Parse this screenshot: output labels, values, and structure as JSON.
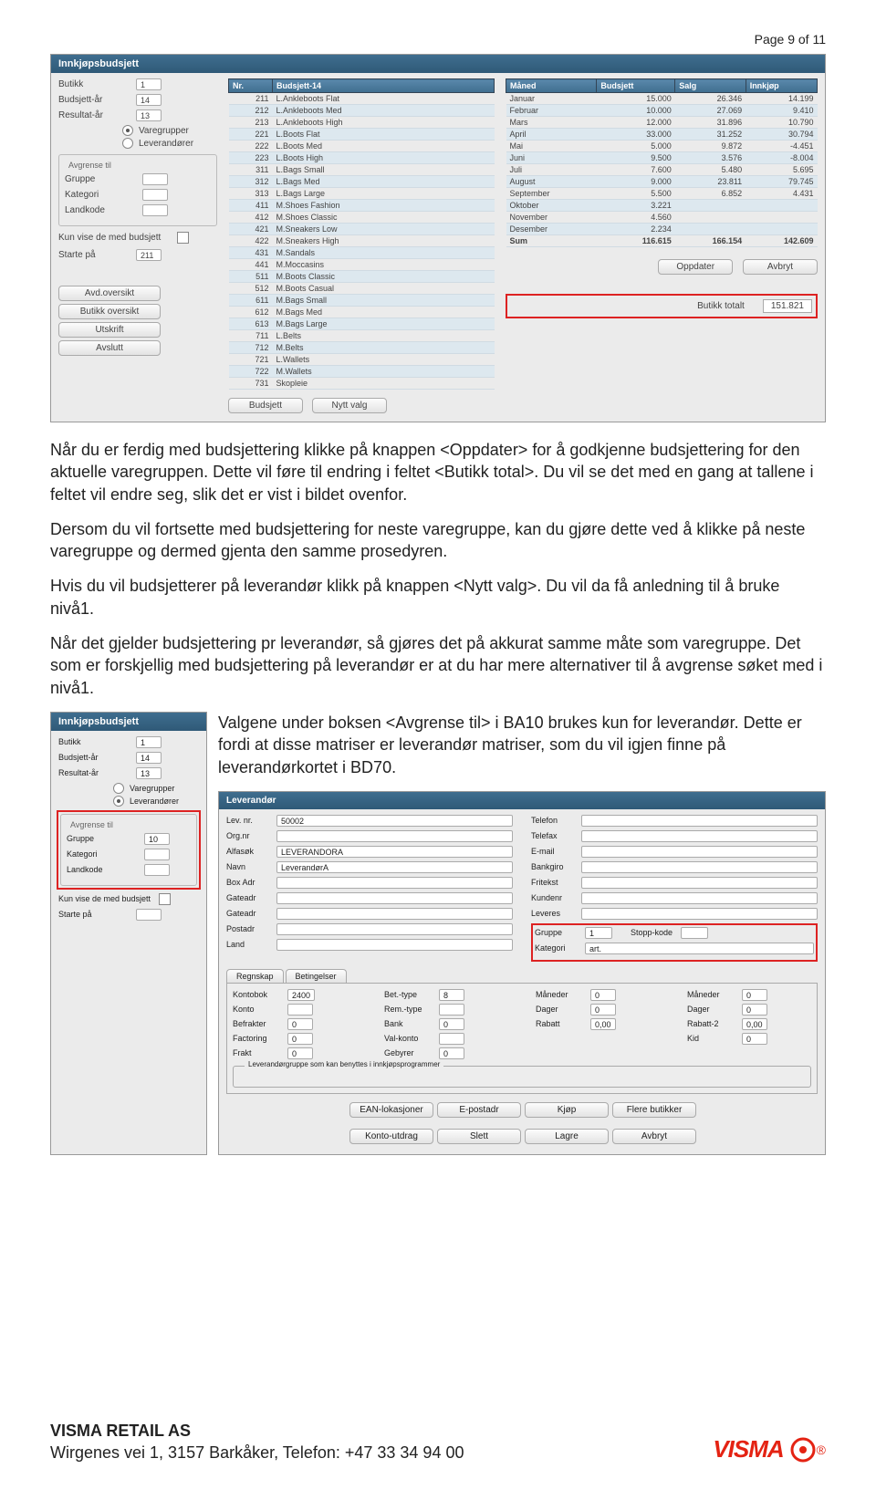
{
  "page_num": "Page 9 of 11",
  "shotA": {
    "title": "Innkjøpsbudsjett",
    "left": {
      "butikk_lbl": "Butikk",
      "butikk_val": "1",
      "budar_lbl": "Budsjett-år",
      "budar_val": "14",
      "resar_lbl": "Resultat-år",
      "resar_val": "13",
      "radio1": "Varegrupper",
      "radio2": "Leverandører",
      "avgrense_title": "Avgrense til",
      "gruppe_lbl": "Gruppe",
      "kategori_lbl": "Kategori",
      "landkode_lbl": "Landkode",
      "kunvise_lbl": "Kun vise de med budsjett",
      "start_lbl": "Starte på",
      "start_val": "211",
      "btn_avd": "Avd.oversikt",
      "btn_butikk": "Butikk oversikt",
      "btn_utskrift": "Utskrift",
      "btn_avslutt": "Avslutt"
    },
    "mid": {
      "h_nr": "Nr.",
      "h_bud": "Budsjett-14",
      "rows": [
        [
          "211",
          "L.Ankleboots Flat"
        ],
        [
          "212",
          "L.Ankleboots Med"
        ],
        [
          "213",
          "L.Ankleboots High"
        ],
        [
          "221",
          "L.Boots Flat"
        ],
        [
          "222",
          "L.Boots Med"
        ],
        [
          "223",
          "L.Boots High"
        ],
        [
          "311",
          "L.Bags Small"
        ],
        [
          "312",
          "L.Bags Med"
        ],
        [
          "313",
          "L.Bags Large"
        ],
        [
          "411",
          "M.Shoes Fashion"
        ],
        [
          "412",
          "M.Shoes Classic"
        ],
        [
          "421",
          "M.Sneakers Low"
        ],
        [
          "422",
          "M.Sneakers High"
        ],
        [
          "431",
          "M.Sandals"
        ],
        [
          "441",
          "M.Moccasins"
        ],
        [
          "511",
          "M.Boots Classic"
        ],
        [
          "512",
          "M.Boots Casual"
        ],
        [
          "611",
          "M.Bags Small"
        ],
        [
          "612",
          "M.Bags Med"
        ],
        [
          "613",
          "M.Bags Large"
        ],
        [
          "711",
          "L.Belts"
        ],
        [
          "712",
          "M.Belts"
        ],
        [
          "721",
          "L.Wallets"
        ],
        [
          "722",
          "M.Wallets"
        ],
        [
          "731",
          "Skopleie"
        ]
      ],
      "btn_bud": "Budsjett",
      "btn_nytt": "Nytt valg"
    },
    "right": {
      "h_maned": "Måned",
      "h_bud": "Budsjett",
      "h_salg": "Salg",
      "h_inn": "Innkjøp",
      "rows": [
        [
          "Januar",
          "15.000",
          "26.346",
          "14.199"
        ],
        [
          "Februar",
          "10.000",
          "27.069",
          "9.410"
        ],
        [
          "Mars",
          "12.000",
          "31.896",
          "10.790"
        ],
        [
          "April",
          "33.000",
          "31.252",
          "30.794"
        ],
        [
          "Mai",
          "5.000",
          "9.872",
          "-4.451"
        ],
        [
          "Juni",
          "9.500",
          "3.576",
          "-8.004"
        ],
        [
          "Juli",
          "7.600",
          "5.480",
          "5.695"
        ],
        [
          "August",
          "9.000",
          "23.811",
          "79.745"
        ],
        [
          "September",
          "5.500",
          "6.852",
          "4.431"
        ],
        [
          "Oktober",
          "3.221",
          "",
          ""
        ],
        [
          "November",
          "4.560",
          "",
          ""
        ],
        [
          "Desember",
          "2.234",
          "",
          ""
        ]
      ],
      "sum_lbl": "Sum",
      "sum_bud": "116.615",
      "sum_salg": "166.154",
      "sum_inn": "142.609",
      "btn_opp": "Oppdater",
      "btn_avb": "Avbryt",
      "totalt_lbl": "Butikk totalt",
      "totalt_val": "151.821"
    }
  },
  "paragraphs": {
    "p1": "Når du er ferdig med budsjettering klikke på knappen <Oppdater> for å godkjenne budsjettering for den aktuelle varegruppen. Dette vil føre til endring i feltet <Butikk total>. Du vil se det med en gang at tallene i feltet vil endre seg, slik det er vist i bildet ovenfor.",
    "p2": "Dersom du vil fortsette med budsjettering for neste varegruppe, kan du gjøre dette ved å klikke på neste varegruppe og dermed gjenta den samme prosedyren.",
    "p3": "Hvis du vil budsjetterer på leverandør klikk på knappen <Nytt valg>. Du vil da få anledning til å bruke nivå1.",
    "p4": "Når det gjelder budsjettering pr leverandør, så gjøres det på akkurat samme måte som varegruppe. Det som er forskjellig med budsjettering på leverandør er at du har mere alternativer til å avgrense søket med i nivå1.",
    "p5": "Valgene under boksen <Avgrense til> i BA10 brukes kun for leverandør. Dette er fordi at disse matriser er leverandør matriser, som du vil igjen finne på leverandørkortet i BD70."
  },
  "shotB": {
    "title": "Innkjøpsbudsjett",
    "butikk_lbl": "Butikk",
    "butikk_val": "1",
    "budar_lbl": "Budsjett-år",
    "budar_val": "14",
    "resar_lbl": "Resultat-år",
    "resar_val": "13",
    "radio1": "Varegrupper",
    "radio2": "Leverandører",
    "avgrense_title": "Avgrense til",
    "gruppe_lbl": "Gruppe",
    "gruppe_val": "10",
    "kategori_lbl": "Kategori",
    "landkode_lbl": "Landkode",
    "kunvise_lbl": "Kun vise de med budsjett",
    "start_lbl": "Starte på"
  },
  "shotC": {
    "title": "Leverandør",
    "lev_lbl": "Lev. nr.",
    "lev_val": "50002",
    "org_lbl": "Org.nr",
    "alfa_lbl": "Alfasøk",
    "alfa_val": "LEVERANDORA",
    "navn_lbl": "Navn",
    "navn_val": "LeverandørA",
    "box_lbl": "Box Adr",
    "gate_lbl": "Gateadr",
    "gate2_lbl": "Gateadr",
    "post_lbl": "Postadr",
    "land_lbl": "Land",
    "tel_lbl": "Telefon",
    "fax_lbl": "Telefax",
    "email_lbl": "E-mail",
    "bank_lbl": "Bankgiro",
    "fritekst_lbl": "Fritekst",
    "kunde_lbl": "Kundenr",
    "leveres_lbl": "Leveres",
    "gruppe_lbl": "Gruppe",
    "gruppe_val": "1",
    "stopp_lbl": "Stopp-kode",
    "kategori_lbl": "Kategori",
    "kategori_val": "art.",
    "tab1": "Regnskap",
    "tab2": "Betingelser",
    "kontobok_lbl": "Kontobok",
    "kontobok_val": "2400",
    "konto_lbl": "Konto",
    "befrakter_lbl": "Befrakter",
    "befrakter_val": "0",
    "factoring_lbl": "Factoring",
    "factoring_val": "0",
    "frakt_lbl": "Frakt",
    "frakt_val": "0",
    "bettype_lbl": "Bet.-type",
    "bettype_val": "8",
    "remtype_lbl": "Rem.-type",
    "bank2_lbl": "Bank",
    "bank2_val": "0",
    "valkonto_lbl": "Val-konto",
    "gebyrer_lbl": "Gebyrer",
    "gebyrer_val": "0",
    "mnd_lbl": "Måneder",
    "mnd_val": "0",
    "dager_lbl": "Dager",
    "dager_val": "0",
    "rabatt_lbl": "Rabatt",
    "rabatt_val": "0,00",
    "mnd2_lbl": "Måneder",
    "mnd2_val": "0",
    "dager2_lbl": "Dager",
    "dager2_val": "0",
    "rabatt2_lbl": "Rabatt-2",
    "rabatt2_val": "0,00",
    "kid_lbl": "Kid",
    "kid_val": "0",
    "legend": "Leverandørgruppe som kan benyttes i innkjøpsprogrammer",
    "btns": [
      "EAN-lokasjoner",
      "E-postadr",
      "Kjøp",
      "Flere butikker",
      "Konto-utdrag",
      "Slett",
      "Lagre",
      "Avbryt"
    ]
  },
  "footer": {
    "l1": "VISMA RETAIL AS",
    "l2": "Wirgenes vei 1, 3157 Barkåker, Telefon: +47 33 34 94 00",
    "logo": "VISMA"
  }
}
